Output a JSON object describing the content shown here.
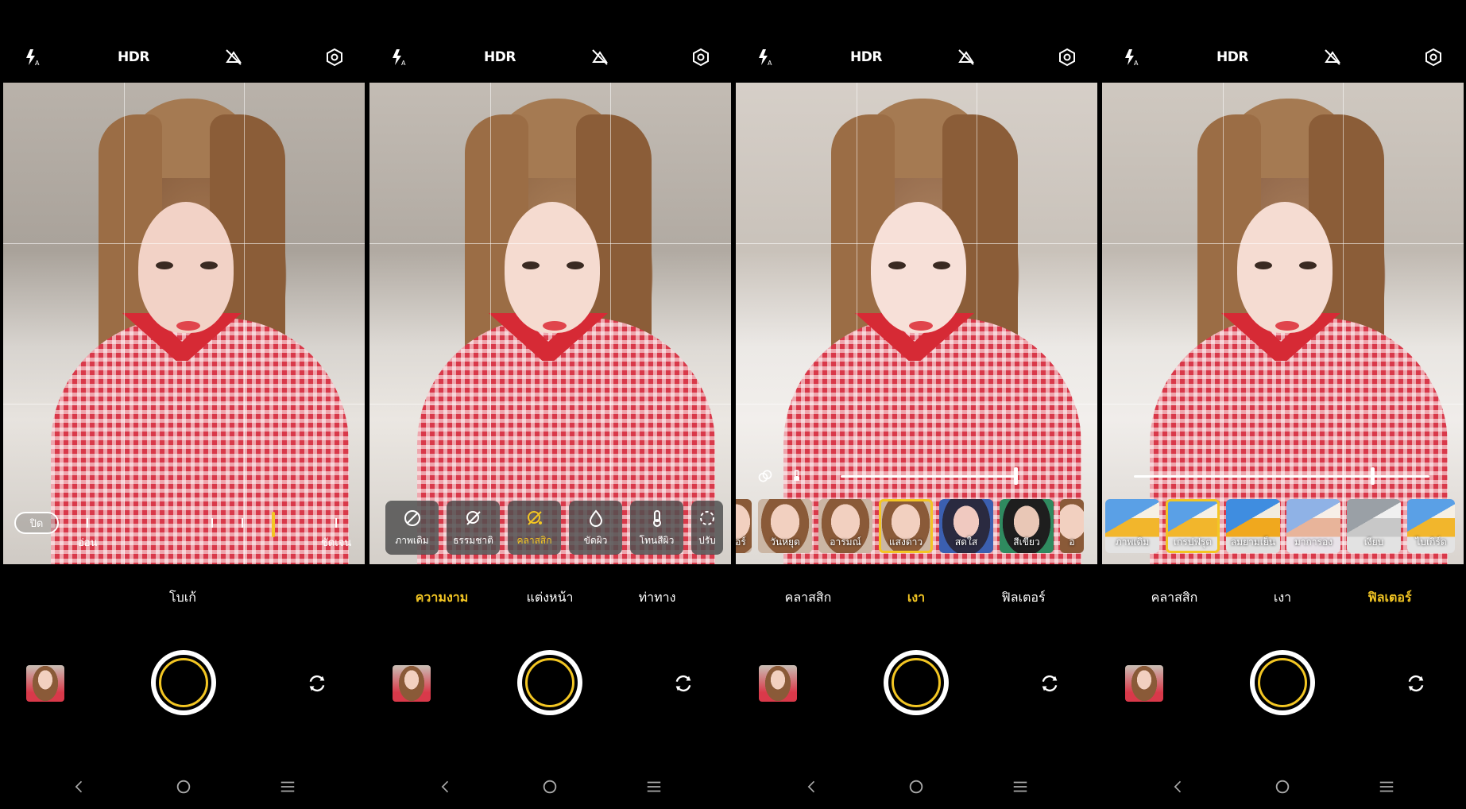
{
  "top_bar": {
    "hdr_label": "HDR"
  },
  "panels": [
    {
      "mode_tabs": [
        "โบเก้"
      ],
      "active_mode": "โบเก้",
      "bokeh": {
        "off_label": "ปิด",
        "left_label": "อ่อน",
        "right_label": "ชัดเจน"
      }
    },
    {
      "mode_tabs": [
        "ความงาม",
        "แต่งหน้า",
        "ท่าทาง"
      ],
      "active_mode": "ความงาม",
      "beauty_items": [
        "ภาพเดิม",
        "ธรรมชาติ",
        "คลาสสิก",
        "ขัดผิว",
        "โทนสีผิว",
        "ปรับ"
      ]
    },
    {
      "mode_tabs": [
        "คลาสสิก",
        "เงา",
        "ฟิลเตอร์"
      ],
      "active_mode": "เงา",
      "shadow_items": [
        "เตอร์",
        "วันหยุด",
        "อารมณ์",
        "แสงดาว",
        "สดใส",
        "สีเขียว",
        "อ"
      ],
      "selected_item": "แสงดาว",
      "slider_value": 0.95
    },
    {
      "mode_tabs": [
        "คลาสสิก",
        "เงา",
        "ฟิลเตอร์"
      ],
      "active_mode": "ฟิลเตอร์",
      "filter_items": [
        "ภาพเดิม",
        "เกรปฟรุต",
        "ลมยามเย็น",
        "มาการอง",
        "เงียบ",
        "ไบเกิร์ด"
      ],
      "selected_item": "เกรปฟรุต",
      "slider_value": 0.8
    }
  ],
  "colors": {
    "accent": "#f3c623",
    "background": "#000000",
    "text": "#ffffff"
  },
  "icons": {
    "flash": "flash-auto-icon",
    "hdr": "hdr-icon",
    "ai": "ai-scene-off-icon",
    "settings": "settings-icon",
    "flip": "flip-camera-icon",
    "back": "back-nav-icon",
    "home": "home-nav-icon",
    "recents": "recents-nav-icon"
  }
}
